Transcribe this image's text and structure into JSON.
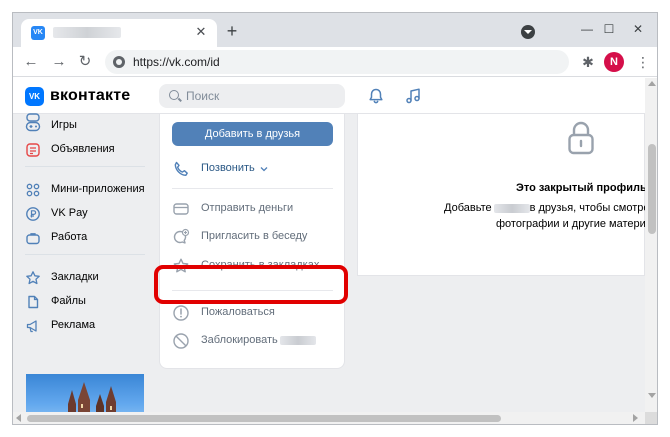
{
  "browser": {
    "tab": {
      "favicon": "VK",
      "title": ""
    },
    "new_tab": "+",
    "window_controls": {
      "minimize": "—",
      "maximize": "☐",
      "close": "✕"
    },
    "nav": {
      "back": "←",
      "forward": "→",
      "reload": "↻"
    },
    "address": "https://vk.com/id",
    "profile_initial": "N",
    "menu": "⋮",
    "extensions": "✱"
  },
  "vk": {
    "logo_mark": "VK",
    "logo_text": "вконтакте",
    "search_placeholder": "Поиск"
  },
  "left_menu": {
    "items": [
      {
        "label": "Игры",
        "icon": "gamepad-icon"
      },
      {
        "label": "Объявления",
        "icon": "ads-icon"
      },
      {
        "label": "Мини-приложения",
        "icon": "mini-apps-icon"
      },
      {
        "label": "VK Pay",
        "icon": "vk-pay-icon"
      },
      {
        "label": "Работа",
        "icon": "briefcase-icon"
      },
      {
        "label": "Закладки",
        "icon": "star-icon"
      },
      {
        "label": "Файлы",
        "icon": "files-icon"
      },
      {
        "label": "Реклама",
        "icon": "megaphone-icon"
      }
    ]
  },
  "actions": {
    "add_friend": "Добавить в друзья",
    "call": "Позвонить",
    "send_money": "Отправить деньги",
    "invite_chat": "Пригласить в беседу",
    "save_bookmarks": "Сохранить в закладках",
    "report": "Пожаловаться",
    "block": "Заблокировать"
  },
  "profile": {
    "closed_title": "Это закрытый профиль",
    "line1_before": "Добавьте",
    "line1_after": "в друзья, чтобы смотре",
    "line2": "фотографии и другие матери"
  },
  "colors": {
    "vk_blue": "#0077ff",
    "button_blue": "#5181b8",
    "highlight_red": "#e10000",
    "profile_avatar": "#d50f4a"
  }
}
